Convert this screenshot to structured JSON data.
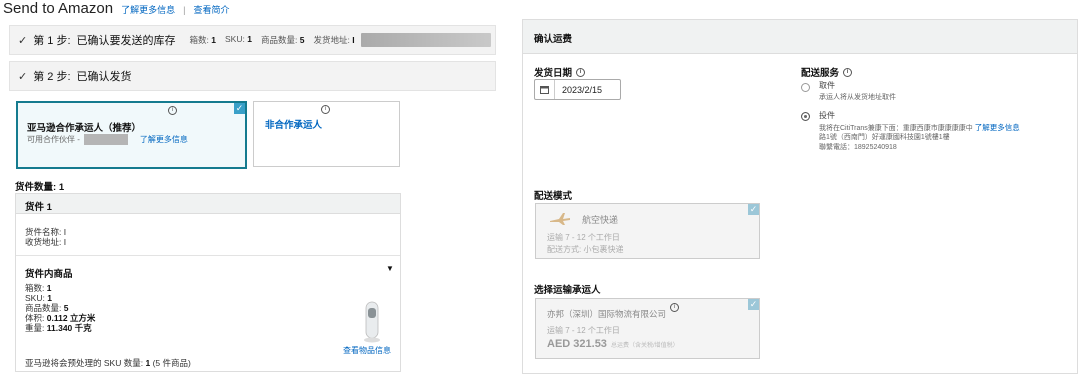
{
  "header": {
    "title": "Send to Amazon",
    "learn_more": "了解更多信息",
    "sep": "|",
    "overview": "查看简介"
  },
  "step1": {
    "check": "✓",
    "label": "第 1 步:",
    "title": "已确认要发送的库存",
    "boxes_label": "箱数:",
    "boxes_value": "1",
    "sku_label": "SKU:",
    "sku_value": "1",
    "qty_label": "商品数量:",
    "qty_value": "5",
    "address_label": "发货地址:",
    "address_value": "I"
  },
  "step2": {
    "check": "✓",
    "label": "第 2 步:",
    "title": "已确认发货"
  },
  "carriers": {
    "partnered": {
      "name": "亚马逊合作承运人（推荐）",
      "partner_label": "可用合作伙伴 -",
      "learn_more": "了解更多信息",
      "check": "✓"
    },
    "non_partnered": {
      "name": "非合作承运人"
    }
  },
  "shipments": {
    "count_label": "货件数量:",
    "count_value": "1",
    "shipment": {
      "title": "货件 1",
      "name_label": "货件名称:",
      "name_value": "I",
      "ship_to_label": "收货地址:",
      "ship_to_value": "I",
      "contents_title": "货件内商品",
      "boxes_label": "箱数:",
      "boxes_value": "1",
      "sku_label": "SKU:",
      "sku_value": "1",
      "qty_label": "商品数量:",
      "qty_value": "5",
      "volume_label": "体积:",
      "volume_value": "0.112 立方米",
      "weight_label": "重量:",
      "weight_value": "11.340 千克",
      "view_items": "查看物品信息",
      "sku_summary_label": "亚马逊将会预处理的 SKU 数量:",
      "sku_summary_value": "1",
      "sku_summary_note": "(5 件商品)",
      "collapse_icon": "▼"
    }
  },
  "confirm": {
    "title": "确认运费",
    "ship_date_label": "发货日期",
    "ship_date_value": "2023/2/15",
    "delivery_service_label": "配送服务",
    "pickup": {
      "label": "取件",
      "desc": "承运人将从发货地址取件"
    },
    "dropoff": {
      "label": "投件",
      "desc_line1": "我将在CitiTrans兼康下面：重康西康市康康康康中",
      "learn_more": "了解更多信息",
      "desc_line2": "路1號（西南門）好運康國科技園1號樓1樓",
      "phone": "聯繫電話：18925240918"
    },
    "delivery_mode_label": "配送模式",
    "air": {
      "name": "航空快递",
      "transit": "运输 7 - 12 个工作日",
      "method": "配送方式: 小包裹快递"
    },
    "select_carrier_label": "选择运输承运人",
    "carrier": {
      "name": "亦邦（深圳）国际物流有限公司",
      "transit": "运输 7 - 12 个工作日",
      "price": "AED 321.53",
      "price_note": "总运费（含关税/增值税）"
    }
  },
  "colors": {
    "link": "#0066c0",
    "selected_border": "#157b8f",
    "check_blue": "#3aa0c8"
  },
  "icons": {
    "info": "info-icon",
    "calendar": "calendar-icon",
    "check": "check-icon",
    "plane": "plane-icon",
    "caret": "caret-down-icon"
  }
}
